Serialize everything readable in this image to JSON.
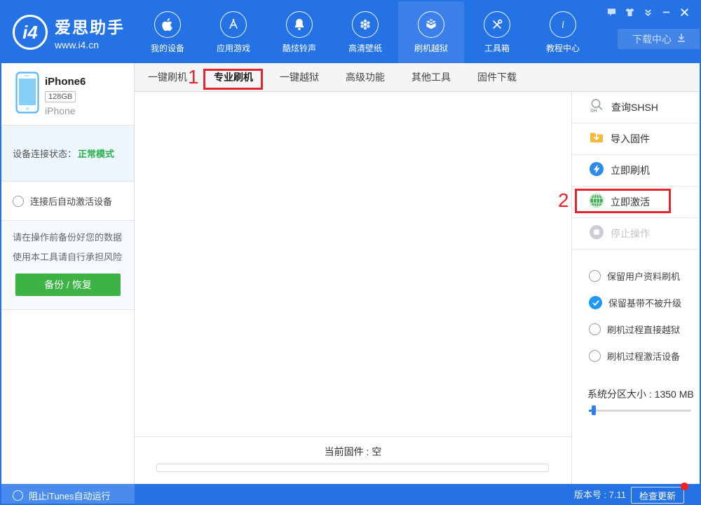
{
  "header": {
    "logo": {
      "badge": "i4",
      "title": "爱思助手",
      "subtitle": "www.i4.cn"
    },
    "nav": [
      {
        "label": "我的设备",
        "icon": "apple-icon",
        "active": false
      },
      {
        "label": "应用游戏",
        "icon": "appstore-icon",
        "active": false
      },
      {
        "label": "酷炫铃声",
        "icon": "bell-icon",
        "active": false
      },
      {
        "label": "高清壁纸",
        "icon": "wallpaper-flower-icon",
        "active": false
      },
      {
        "label": "刷机越狱",
        "icon": "jailbreak-box-icon",
        "active": true
      },
      {
        "label": "工具箱",
        "icon": "toolbox-icon",
        "active": false
      },
      {
        "label": "教程中心",
        "icon": "info-icon",
        "active": false
      }
    ],
    "window_controls": [
      "comment-icon",
      "skin-icon",
      "tray-minimize-icon",
      "minimize-icon",
      "close-icon"
    ],
    "download_center_label": "下载中心"
  },
  "tabs": {
    "items": [
      "一键刷机",
      "专业刷机",
      "一键越狱",
      "高级功能",
      "其他工具",
      "固件下载"
    ],
    "active_index": 1
  },
  "annotations": {
    "step1": "1",
    "step2": "2"
  },
  "sidebar": {
    "device": {
      "name": "iPhone6",
      "capacity": "128GB",
      "model": "iPhone"
    },
    "status": {
      "label": "设备连接状态：",
      "value": "正常模式"
    },
    "auto_activate_label": "连接后自动激活设备",
    "warning_line1": "请在操作前备份好您的数据",
    "warning_line2": "使用本工具请自行承担风险",
    "backup_button_label": "备份 / 恢复"
  },
  "right_panel": {
    "actions": [
      {
        "label": "查询SHSH",
        "icon": "shsh-search-icon",
        "disabled": false
      },
      {
        "label": "导入固件",
        "icon": "import-firmware-icon",
        "disabled": false
      },
      {
        "label": "立即刷机",
        "icon": "flash-icon",
        "disabled": false
      },
      {
        "label": "立即激活",
        "icon": "activate-globe-icon",
        "disabled": false
      },
      {
        "label": "停止操作",
        "icon": "stop-icon",
        "disabled": true
      }
    ],
    "options": [
      {
        "label": "保留用户资料刷机",
        "checked": false
      },
      {
        "label": "保留基带不被升级",
        "checked": true
      },
      {
        "label": "刷机过程直接越狱",
        "checked": false
      },
      {
        "label": "刷机过程激活设备",
        "checked": false
      }
    ],
    "partition_label": "系统分区大小 : 1350 MB"
  },
  "main": {
    "firmware_label": "当前固件 : 空",
    "progress_percent": 0
  },
  "bottom_bar": {
    "block_itunes_label": "阻止iTunes自动运行",
    "version_label": "版本号 : 7.11",
    "check_update_label": "检查更新"
  },
  "colors": {
    "header_bg": "#2472e4",
    "active_nav_bg": "#3b80ea",
    "status_green": "#28b24a",
    "backup_green": "#3cb344",
    "annotation_red": "#e8252c",
    "checked_radio_blue": "#1f97f4",
    "flash_circle_blue": "#2d8ce8",
    "activate_green": "#3fae52",
    "folder_yellow": "#f6b93b",
    "update_dot_red": "#ff1f1f"
  }
}
